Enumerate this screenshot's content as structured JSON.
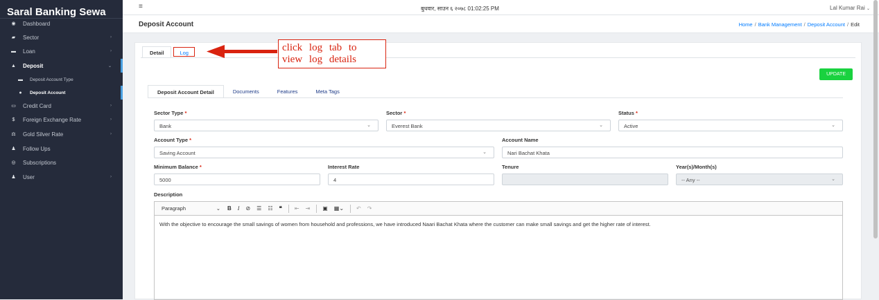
{
  "app": {
    "brand": "Saral Banking Sewa"
  },
  "sidebar": {
    "items": [
      {
        "label": "Dashboard",
        "icon": "dashboard-icon",
        "glyph": "◉"
      },
      {
        "label": "Sector",
        "icon": "sector-icon",
        "glyph": "▰"
      },
      {
        "label": "Loan",
        "icon": "loan-icon",
        "glyph": "▬"
      },
      {
        "label": "Deposit",
        "icon": "deposit-icon",
        "glyph": "▲"
      },
      {
        "label": "Deposit Account Type",
        "icon": "id-card-icon",
        "glyph": "▬"
      },
      {
        "label": "Deposit Account",
        "icon": "user-circle-icon",
        "glyph": "●"
      },
      {
        "label": "Credit Card",
        "icon": "credit-card-icon",
        "glyph": "▭"
      },
      {
        "label": "Foreign Exchange Rate",
        "icon": "dollar-icon",
        "glyph": "$"
      },
      {
        "label": "Gold Silver Rate",
        "icon": "scale-icon",
        "glyph": "⚖"
      },
      {
        "label": "Follow Ups",
        "icon": "user-plus-icon",
        "glyph": "♟"
      },
      {
        "label": "Subscriptions",
        "icon": "rss-icon",
        "glyph": "◎"
      },
      {
        "label": "User",
        "icon": "users-icon",
        "glyph": "♟"
      }
    ]
  },
  "topbar": {
    "datetime": "बुधवार, साउन ६ २०७८ 01:02:25 PM",
    "user": "Lal Kumar Rai"
  },
  "header": {
    "title": "Deposit Account",
    "breadcrumb": {
      "home": "Home",
      "bank": "Bank Management",
      "deposit": "Deposit Account",
      "current": "Edit"
    }
  },
  "tabs": {
    "detail": "Detail",
    "log": "Log"
  },
  "callout": {
    "line1": "click log tab to",
    "line2": "view log details"
  },
  "update_label": "UPDATE",
  "inner_tabs": {
    "detail": "Deposit Account Detail",
    "documents": "Documents",
    "features": "Features",
    "meta": "Meta Tags"
  },
  "form": {
    "sector_type": {
      "label": "Sector Type",
      "value": "Bank"
    },
    "sector": {
      "label": "Sector",
      "value": "Everest Bank"
    },
    "status": {
      "label": "Status",
      "value": "Active"
    },
    "account_type": {
      "label": "Account Type",
      "value": "Saving Account"
    },
    "account_name": {
      "label": "Account Name",
      "value": "Nari Bachat Khata"
    },
    "min_balance": {
      "label": "Minimum Balance",
      "value": "5000"
    },
    "interest_rate": {
      "label": "Interest Rate",
      "value": "4"
    },
    "tenure": {
      "label": "Tenure",
      "value": ""
    },
    "year_month": {
      "label": "Year(s)/Month(s)",
      "value": "-- Any --"
    },
    "description": {
      "label": "Description"
    }
  },
  "editor": {
    "paragraph": "Paragraph",
    "content": "With the objective to encourage the small savings of women from household and professions, we have introduced Naari Bachat Khata where the customer can make small savings and get the higher rate of interest."
  },
  "colors": {
    "sidebar_bg": "#252b3b",
    "accent": "#007bff",
    "update": "#19d23f",
    "annotation": "#d9230f"
  }
}
